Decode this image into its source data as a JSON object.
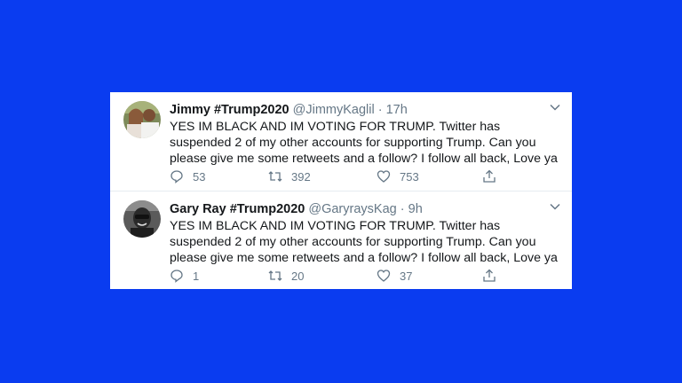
{
  "tweets": [
    {
      "display_name": "Jimmy #Trump2020",
      "handle": "@JimmyKaglil",
      "separator": "·",
      "time": "17h",
      "text": "YES IM BLACK AND IM VOTING FOR TRUMP. Twitter  has suspended 2 of my other accounts for supporting Trump. Can you please give me some retweets and a follow? I follow all back, Love ya",
      "replies": "53",
      "retweets": "392",
      "likes": "753",
      "avatar_icon": "photo-avatar"
    },
    {
      "display_name": "Gary Ray #Trump2020",
      "handle": "@GaryraysKag",
      "separator": "·",
      "time": "9h",
      "text": "YES IM BLACK AND IM VOTING FOR TRUMP. Twitter  has suspended 2 of my other accounts for supporting Trump. Can you please give me some retweets and a follow? I follow all back, Love ya",
      "replies": "1",
      "retweets": "20",
      "likes": "37",
      "avatar_icon": "photo-avatar"
    }
  ],
  "colors": {
    "background": "#0a3cf0",
    "card": "#ffffff",
    "text": "#14171a",
    "muted": "#657786"
  }
}
